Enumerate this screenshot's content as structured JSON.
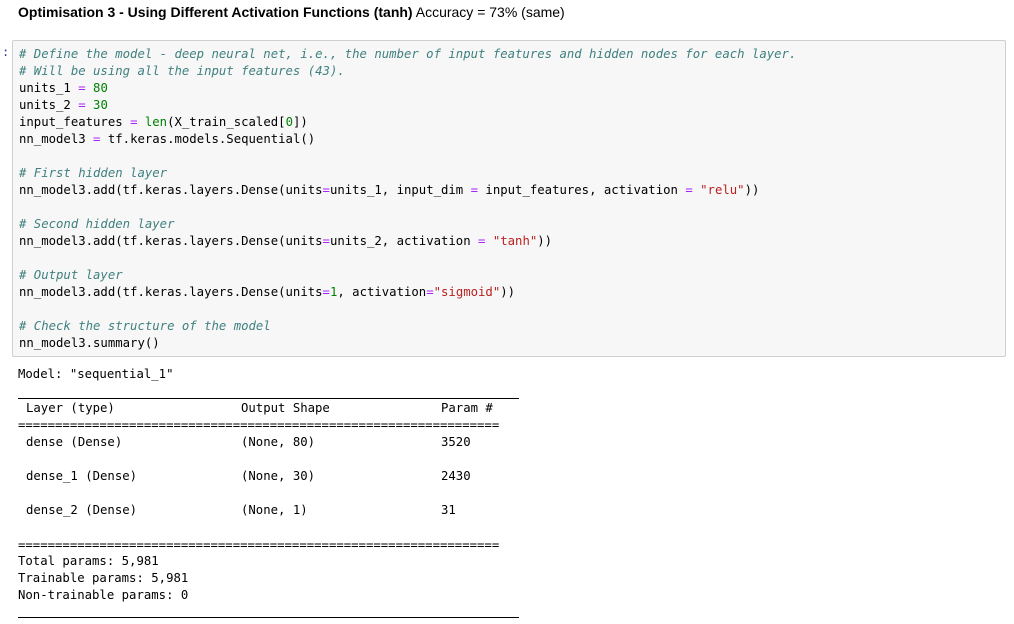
{
  "heading": {
    "bold": "Optimisation 3 - Using Different Activation Functions (tanh)",
    "rest": " Accuracy = 73% (same)"
  },
  "prompt": ":",
  "code_lines": [
    {
      "t": [
        [
          "cm",
          "# Define the model - deep neural net, i.e., the number of input features and hidden nodes for each layer."
        ]
      ]
    },
    {
      "t": [
        [
          "cm",
          "# Will be using all the input features (43)."
        ]
      ]
    },
    {
      "t": [
        [
          "",
          "units_1 "
        ],
        [
          "op",
          "="
        ],
        [
          "",
          " "
        ],
        [
          "nm",
          "80"
        ]
      ]
    },
    {
      "t": [
        [
          "",
          "units_2 "
        ],
        [
          "op",
          "="
        ],
        [
          "",
          " "
        ],
        [
          "nm",
          "30"
        ]
      ]
    },
    {
      "t": [
        [
          "",
          "input_features "
        ],
        [
          "op",
          "="
        ],
        [
          "",
          " "
        ],
        [
          "nm",
          "len"
        ],
        [
          "",
          "(X_train_scaled["
        ],
        [
          "nm",
          "0"
        ],
        [
          "",
          "])"
        ]
      ]
    },
    {
      "t": [
        [
          "",
          "nn_model3 "
        ],
        [
          "op",
          "="
        ],
        [
          "",
          " tf.keras.models.Sequential()"
        ]
      ]
    },
    {
      "t": [
        [
          "",
          ""
        ]
      ]
    },
    {
      "t": [
        [
          "cm",
          "# First hidden layer"
        ]
      ]
    },
    {
      "t": [
        [
          "",
          "nn_model3.add(tf.keras.layers.Dense(units"
        ],
        [
          "op",
          "="
        ],
        [
          "",
          "units_1, input_dim "
        ],
        [
          "op",
          "="
        ],
        [
          "",
          " input_features, activation "
        ],
        [
          "op",
          "="
        ],
        [
          "",
          " "
        ],
        [
          "st",
          "\"relu\""
        ],
        [
          "",
          "))"
        ]
      ]
    },
    {
      "t": [
        [
          "",
          ""
        ]
      ]
    },
    {
      "t": [
        [
          "cm",
          "# Second hidden layer"
        ]
      ]
    },
    {
      "t": [
        [
          "",
          "nn_model3.add(tf.keras.layers.Dense(units"
        ],
        [
          "op",
          "="
        ],
        [
          "",
          "units_2, activation "
        ],
        [
          "op",
          "="
        ],
        [
          "",
          " "
        ],
        [
          "st",
          "\"tanh\""
        ],
        [
          "",
          "))"
        ]
      ]
    },
    {
      "t": [
        [
          "",
          ""
        ]
      ]
    },
    {
      "t": [
        [
          "cm",
          "# Output layer"
        ]
      ]
    },
    {
      "t": [
        [
          "",
          "nn_model3.add(tf.keras.layers.Dense(units"
        ],
        [
          "op",
          "="
        ],
        [
          "nm",
          "1"
        ],
        [
          "",
          ", activation"
        ],
        [
          "op",
          "="
        ],
        [
          "st",
          "\"sigmoid\""
        ],
        [
          "",
          "))"
        ]
      ]
    },
    {
      "t": [
        [
          "",
          ""
        ]
      ]
    },
    {
      "t": [
        [
          "cm",
          "# Check the structure of the model"
        ]
      ]
    },
    {
      "t": [
        [
          "",
          "nn_model3.summary()"
        ]
      ]
    }
  ],
  "summary": {
    "model_line": "Model: \"sequential_1\"",
    "headers": [
      "Layer (type)",
      "Output Shape",
      "Param #"
    ],
    "rows": [
      [
        "dense (Dense)",
        "(None, 80)",
        "3520"
      ],
      [
        "dense_1 (Dense)",
        "(None, 30)",
        "2430"
      ],
      [
        "dense_2 (Dense)",
        "(None, 1)",
        "31"
      ]
    ],
    "totals": [
      "Total params: 5,981",
      "Trainable params: 5,981",
      "Non-trainable params: 0"
    ],
    "eq_rule": "================================================================="
  }
}
